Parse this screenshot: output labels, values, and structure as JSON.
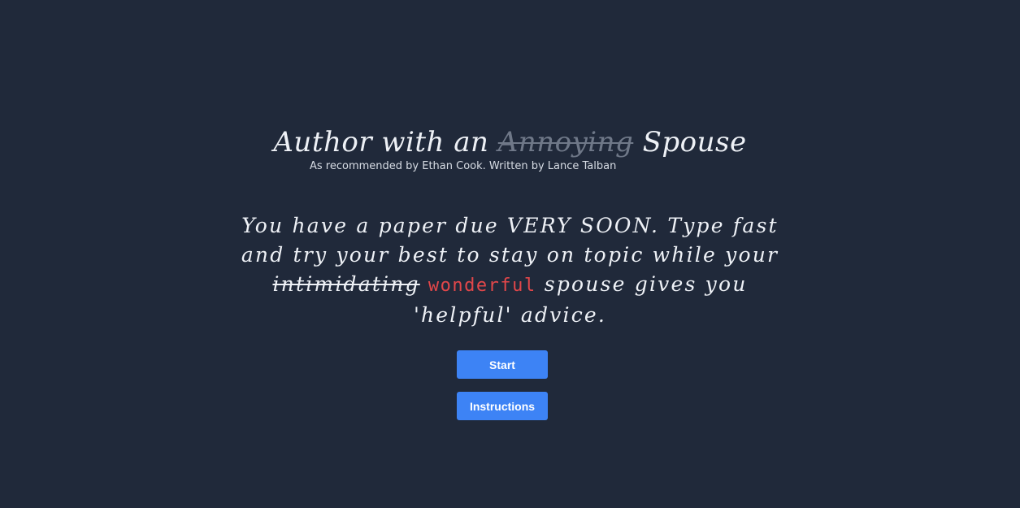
{
  "title": {
    "before": "Author with an ",
    "struck": "Annoying",
    "after": " Spouse"
  },
  "subtitle": "As recommended by Ethan Cook. Written by Lance Talban",
  "blurb": {
    "line_part1": "You have a paper due VERY SOON. Type fast and try your best to stay on topic while your ",
    "struck": "intimidating",
    "accent": "wonderful",
    "line_part2": " spouse gives you 'helpful' advice."
  },
  "buttons": {
    "start_label": "Start",
    "instructions_label": "Instructions"
  },
  "colors": {
    "background": "#20293a",
    "accent_word": "#e2474a",
    "button": "#3d83f5",
    "struck_title": "#6f7888"
  }
}
